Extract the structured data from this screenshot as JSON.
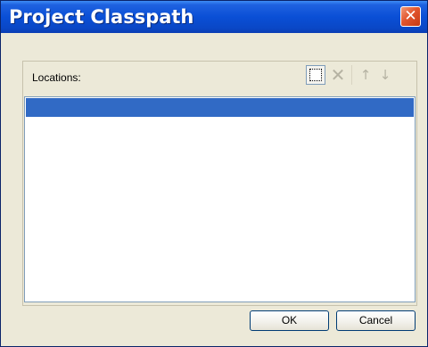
{
  "window": {
    "title": "Project Classpath",
    "close_glyph": "✕"
  },
  "locations": {
    "label": "Locations:",
    "toolbar": {
      "new_icon": "new-folder-icon",
      "remove_icon": "delete-x-icon",
      "remove_glyph": "✕",
      "up_icon": "arrow-up-icon",
      "up_glyph": "↑",
      "down_icon": "arrow-down-icon",
      "down_glyph": "↓"
    },
    "list": {
      "items": [
        ""
      ],
      "selected_index": 0
    }
  },
  "buttons": {
    "ok": "OK",
    "cancel": "Cancel"
  },
  "colors": {
    "titlebar": "#0a4fd6",
    "selection": "#316ac5",
    "dialog_bg": "#ece9d8",
    "close_button": "#e2552d"
  }
}
